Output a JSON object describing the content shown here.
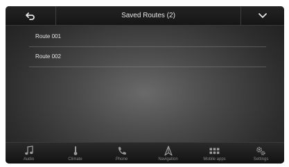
{
  "header": {
    "title": "Saved Routes (2)",
    "back_icon": "back-arrow-icon",
    "menu_icon": "chevron-down-icon"
  },
  "routes": [
    {
      "label": "Route 001"
    },
    {
      "label": "Route 002"
    }
  ],
  "nav": [
    {
      "label": "Audio",
      "icon": "music-note-icon"
    },
    {
      "label": "Climate",
      "icon": "climate-icon"
    },
    {
      "label": "Phone",
      "icon": "phone-icon"
    },
    {
      "label": "Navigation",
      "icon": "navigation-icon"
    },
    {
      "label": "Mobile apps",
      "icon": "apps-grid-icon"
    },
    {
      "label": "Settings",
      "icon": "gears-icon"
    }
  ]
}
